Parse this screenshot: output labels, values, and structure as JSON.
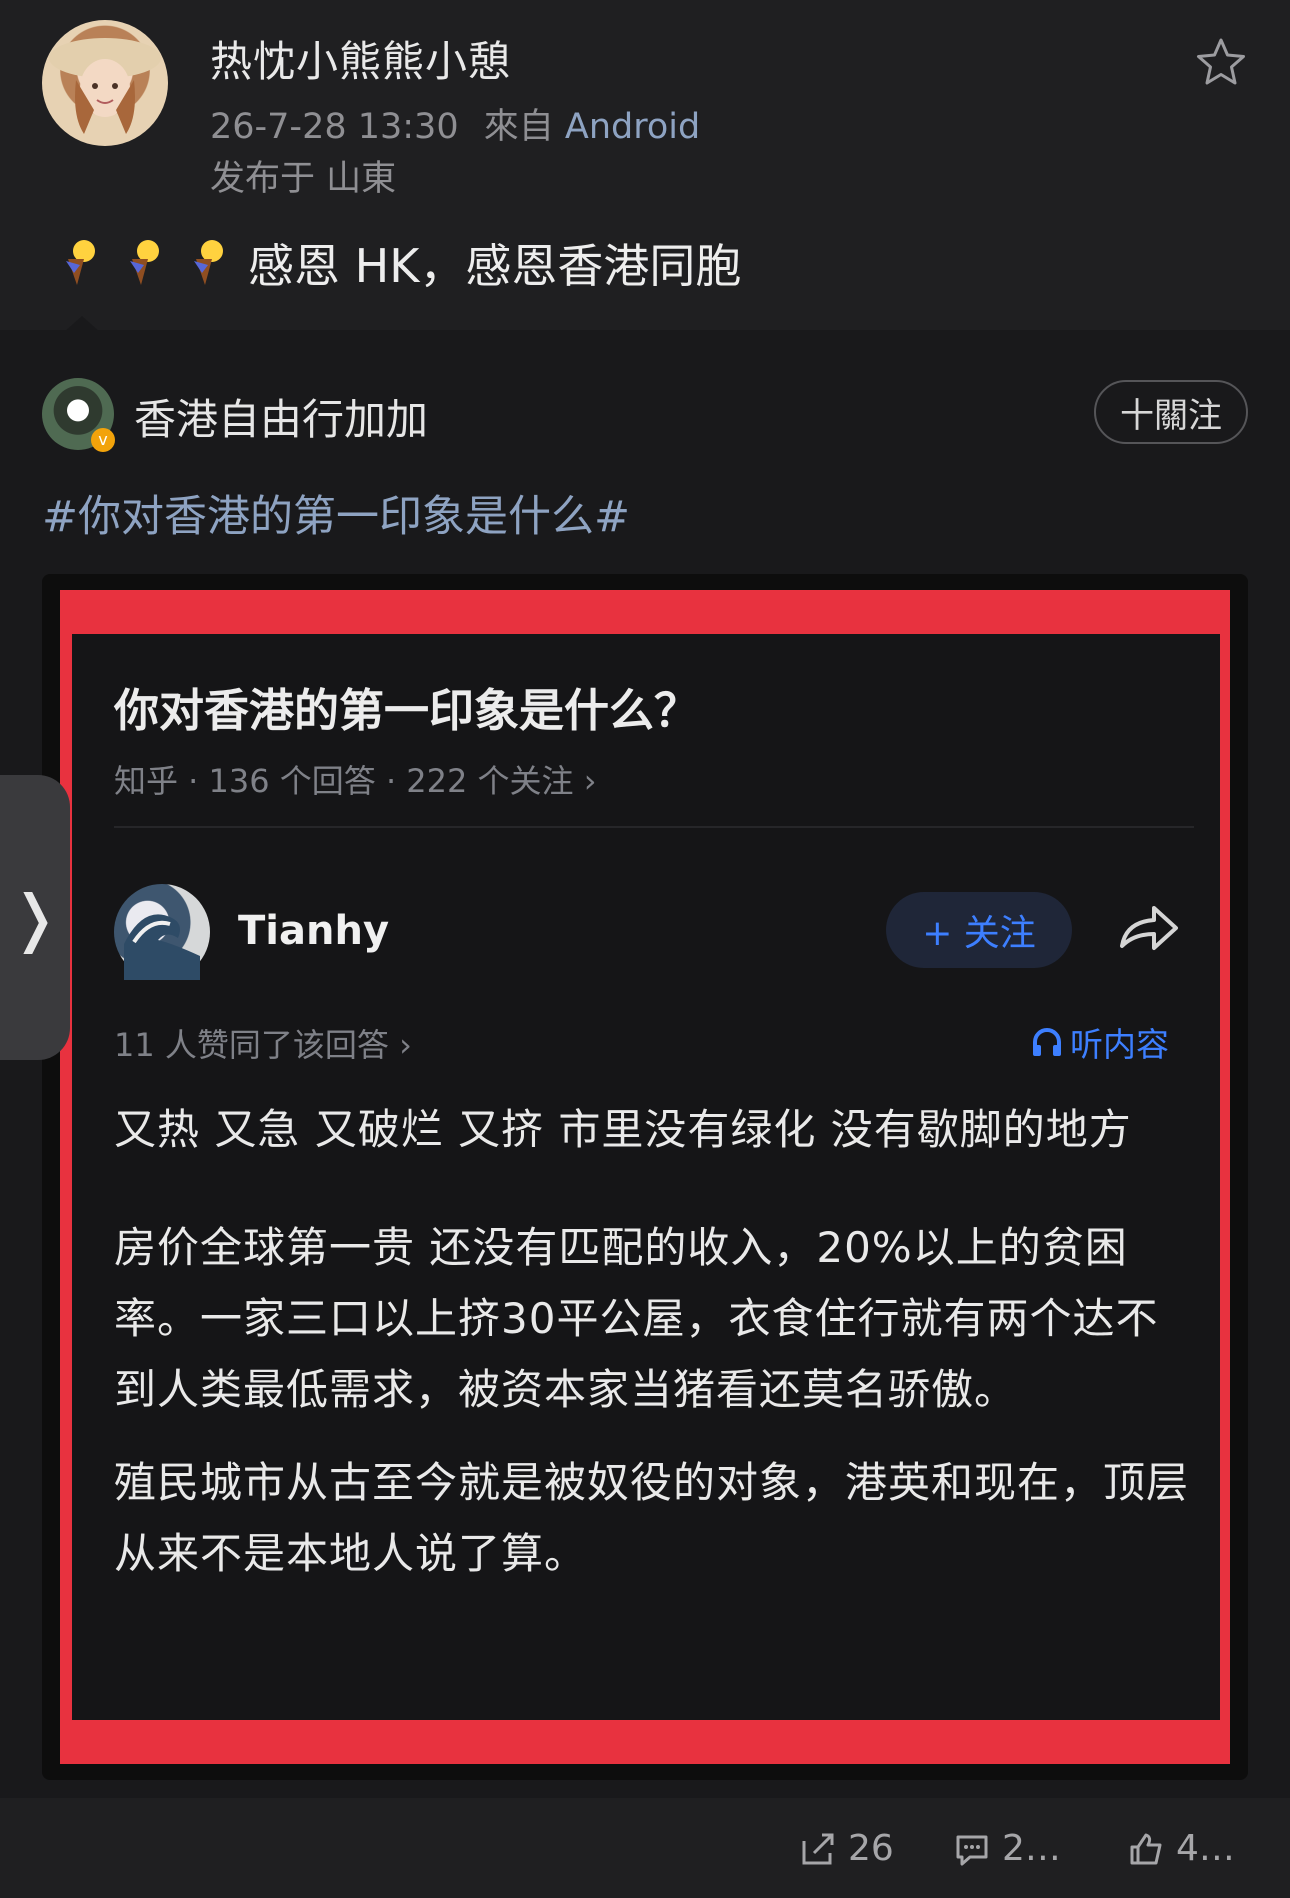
{
  "post": {
    "username": "热忱小熊熊小憩",
    "time": "26-7-28 13:30",
    "source_prefix": "來自",
    "device": "Android",
    "location": "发布于 山東",
    "text": "感恩 HK，感恩香港同胞",
    "emoji_icons": [
      "torch-icon",
      "torch-icon",
      "torch-icon"
    ]
  },
  "repost": {
    "name": "香港自由行加加",
    "follow_label": "十關注",
    "hashtag": "#你对香港的第一印象是什么#"
  },
  "embedded": {
    "question_title": "你对香港的第一印象是什么？",
    "question_meta": "知乎 · 136 个回答 · 222 个关注 ›",
    "answerer": "Tianhy",
    "follow_label": "+ 关注",
    "likes": "11 人赞同了该回答 ›",
    "listen_label": "听内容",
    "paragraphs": [
      "又热 又急 又破烂 又挤 市里没有绿化 没有歇脚的地方",
      "房价全球第一贵 还没有匹配的收入，20%以上的贫困率。一家三口以上挤30平公屋，衣食住行就有两个达不到人类最低需求，被资本家当猪看还莫名骄傲。",
      "殖民城市从古至今就是被奴役的对象，港英和现在，顶层从来不是本地人说了算。"
    ]
  },
  "side_tab": {
    "label": "❭"
  },
  "footer": {
    "repost_count": "26",
    "comment_count": "2…",
    "like_count": "4…"
  },
  "colors": {
    "frame_red": "#e8323f",
    "link_blue": "#8ea3c2",
    "accent_blue": "#3d7fff"
  }
}
